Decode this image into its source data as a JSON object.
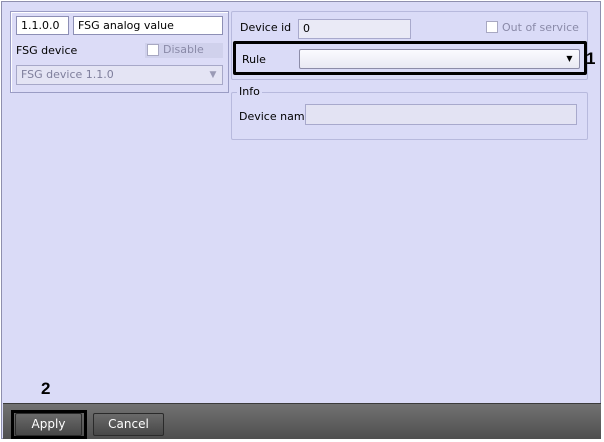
{
  "object": {
    "id": "1.1.0.0",
    "name": "FSG analog value"
  },
  "parent": {
    "label": "FSG device",
    "disable_label": "Disable",
    "selected": "FSG device 1.1.0"
  },
  "device": {
    "id_label": "Device id",
    "id_value": "0",
    "out_of_service_label": "Out of service"
  },
  "rule": {
    "label": "Rule",
    "value": ""
  },
  "info": {
    "caption": "Info",
    "device_name_label": "Device name",
    "device_name_value": ""
  },
  "annotations": {
    "marker_1": "1",
    "marker_2": "2"
  },
  "buttons": {
    "apply": "Apply",
    "cancel": "Cancel"
  },
  "icons": {
    "dropdown": "chevron-down-icon",
    "checkbox": "checkbox-icon"
  }
}
